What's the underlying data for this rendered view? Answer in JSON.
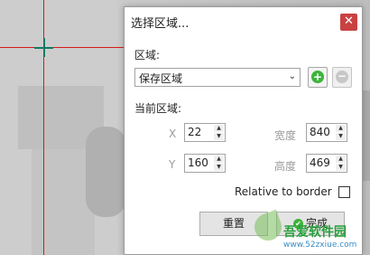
{
  "dialog": {
    "title": "选择区域...",
    "close_glyph": "✕",
    "region_label": "区域:",
    "region_select": {
      "value": "保存区域",
      "arrow": "⌄"
    },
    "add_glyph": "+",
    "remove_glyph": "−",
    "current_region_label": "当前区域:",
    "x_label": "X",
    "y_label": "Y",
    "width_label": "宽度",
    "height_label": "高度",
    "x_value": "22",
    "y_value": "160",
    "width_value": "840",
    "height_value": "469",
    "relative_label": "Relative to border",
    "relative_checked": false,
    "reset_label": "重置",
    "done_label": "完成"
  },
  "watermark": {
    "site_name": "吾爱软件园",
    "site_url": "www.52zxiue.com"
  },
  "colors": {
    "crosshair_lines": "#d21c1c",
    "cursor": "#0e7a65",
    "close_button": "#c94242",
    "add_button": "#3db33b"
  },
  "icons": [
    "crosshair-cursor-icon",
    "close-icon",
    "add-icon",
    "remove-icon",
    "spin-up-icon",
    "spin-down-icon",
    "checkmark-icon"
  ]
}
